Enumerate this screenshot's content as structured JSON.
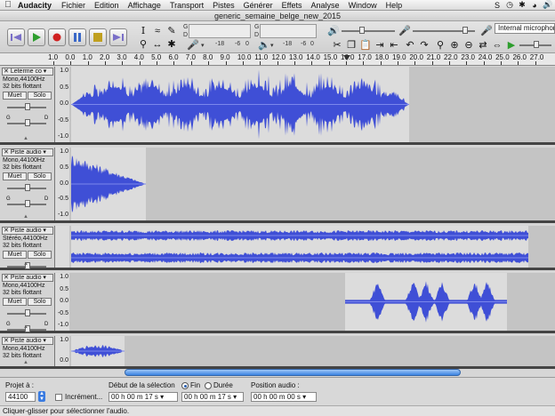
{
  "menubar": {
    "app_name": "Audacity",
    "items": [
      "Fichier",
      "Edition",
      "Affichage",
      "Transport",
      "Pistes",
      "Générer",
      "Effets",
      "Analyse",
      "Window",
      "Help"
    ]
  },
  "window": {
    "title": "generic_semaine_belge_new_2015"
  },
  "toolbar": {
    "meter_ticks_left": [
      "-18",
      "-6",
      "0"
    ],
    "meter_ticks_right": [
      "-18",
      "-6",
      "0"
    ],
    "meter_ticks_play": [
      "-18",
      "-6",
      "0"
    ],
    "rec_meter_letters": [
      "G",
      "D"
    ],
    "play_meter_letters": [
      "G",
      "D"
    ],
    "input_source": "Internal microphone"
  },
  "ruler": {
    "ticks": [
      "1.0",
      "0.0",
      "1.0",
      "2.0",
      "3.0",
      "4.0",
      "5.0",
      "6.0",
      "7.0",
      "8.0",
      "9.0",
      "10.0",
      "11.0",
      "12.0",
      "13.0",
      "14.0",
      "15.0",
      "16.0",
      "17.0",
      "18.0",
      "19.0",
      "20.0",
      "21.0",
      "22.0",
      "23.0",
      "24.0",
      "25.0",
      "26.0",
      "27.0"
    ]
  },
  "tracks": [
    {
      "name": "Leterme co",
      "info": [
        "Mono,44100Hz",
        "32 bits flottant"
      ],
      "mute": "Muet",
      "solo": "Solo",
      "scale": [
        "1.0",
        "0.5",
        "0.0",
        "-0.5",
        "-1.0"
      ]
    },
    {
      "name": "Piste audio",
      "info": [
        "Mono,44100Hz",
        "32 bits flottant"
      ],
      "mute": "Muet",
      "solo": "Solo",
      "scale": [
        "1.0",
        "0.5",
        "0.0",
        "-0.5",
        "-1.0"
      ]
    },
    {
      "name": "Piste audio",
      "info": [
        "Stéréo,44100Hz",
        "32 bits flottant"
      ],
      "mute": "Muet",
      "solo": "Solo",
      "scale": []
    },
    {
      "name": "Piste audio",
      "info": [
        "Mono,44100Hz",
        "32 bits flottant"
      ],
      "mute": "Muet",
      "solo": "Solo",
      "scale": [
        "1.0",
        "0.5",
        "0.0",
        "-0.5",
        "-1.0"
      ]
    },
    {
      "name": "Piste audio",
      "info": [
        "Mono,44100Hz",
        "32 bits flottant"
      ],
      "mute": "",
      "solo": "",
      "scale": [
        "1.0",
        "0.0"
      ]
    }
  ],
  "gain_pan": {
    "g": "G",
    "d": "D"
  },
  "selection_bar": {
    "project_rate_label": "Projet à :",
    "project_rate": "44100",
    "increment_label": "Incrément...",
    "selection_start_label": "Début de la sélection",
    "end_option": "Fin",
    "duration_option": "Durée",
    "audio_position_label": "Position audio :",
    "time_start": "00 h 00 m 17 s",
    "time_end": "00 h 00 m 17 s",
    "time_position": "00 h 00 m 00 s"
  },
  "status_text": "Cliquer-glisser pour sélectionner l'audio.",
  "colors": {
    "wave": "#3f4fd6",
    "wave_rms": "#7b87ec",
    "selection_blue": "#3a82e0"
  }
}
